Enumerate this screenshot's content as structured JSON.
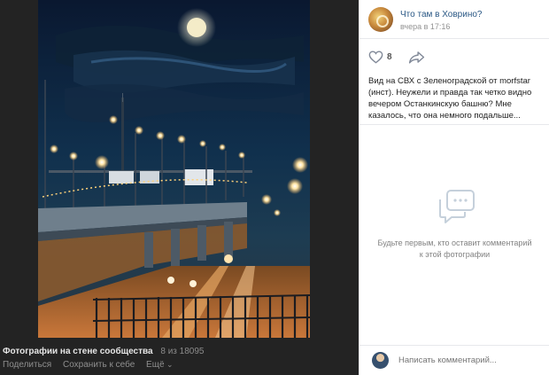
{
  "viewer": {
    "album_title": "Фотографии на стене сообщества",
    "counter": "8 из 18095",
    "actions": {
      "share": "Поделиться",
      "save": "Сохранить к себе",
      "more": "Ещё"
    }
  },
  "post": {
    "author": "Что там в Ховрино?",
    "time": "вчера в 17:16",
    "likes": "8",
    "caption": "Вид на СВХ с Зеленоградской от morfstar (инст). Неужели и правда так четко видно вечером Останкинскую башню? Мне казалось, что она немного подальше..."
  },
  "comments": {
    "empty_text": "Будьте первым, кто оставит комментарий к этой фотографии",
    "placeholder": "Написать комментарий..."
  },
  "colors": {
    "link": "#2a5885",
    "viewer_bg": "#232323",
    "panel_bg": "#ffffff"
  },
  "icons": [
    "heart-icon",
    "share-arrow-icon",
    "chat-bubbles-icon",
    "avatar"
  ]
}
